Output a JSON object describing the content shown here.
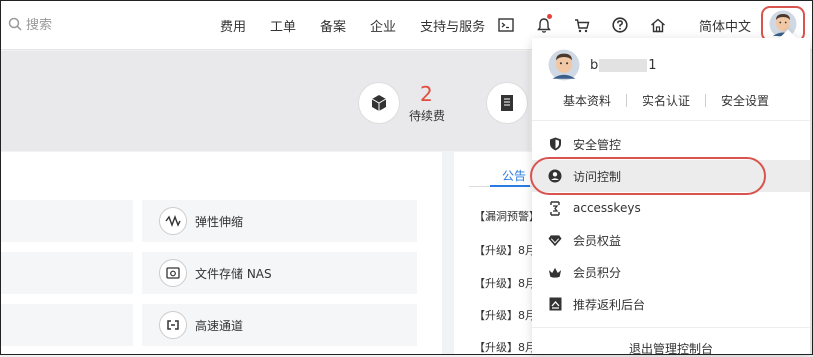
{
  "search": {
    "placeholder": "搜索"
  },
  "nav": [
    {
      "label": "费用"
    },
    {
      "label": "工单"
    },
    {
      "label": "备案"
    },
    {
      "label": "企业"
    },
    {
      "label": "支持与服务"
    }
  ],
  "top_icons": [
    "terminal-icon",
    "bell-icon",
    "cart-icon",
    "help-icon",
    "home-icon"
  ],
  "notification_dot": true,
  "language": "简体中文",
  "stat": {
    "value": "2",
    "label": "待续费"
  },
  "services": [
    {
      "label": "弹性伸缩",
      "icon": "scaling-icon"
    },
    {
      "label": "文件存储 NAS",
      "icon": "nas-icon"
    },
    {
      "label": "高速通道",
      "icon": "express-connect-icon"
    }
  ],
  "notices": {
    "tab": "公告",
    "items": [
      "【漏洞预警】",
      "【升级】8月",
      "【升级】8月",
      "【升级】8月",
      "【升级】8月"
    ]
  },
  "user_menu": {
    "username_start": "b",
    "username_end": "1",
    "links": [
      "基本资料",
      "实名认证",
      "安全设置"
    ],
    "items": [
      {
        "label": "安全管控",
        "icon": "shield-icon"
      },
      {
        "label": "访问控制",
        "icon": "user-circle-icon"
      },
      {
        "label": "accesskeys",
        "icon": "key-icon"
      },
      {
        "label": "会员权益",
        "icon": "diamond-icon"
      },
      {
        "label": "会员积分",
        "icon": "crown-icon"
      },
      {
        "label": "推荐返利后台",
        "icon": "rebate-icon"
      }
    ],
    "highlighted_item": "访问控制",
    "logout": "退出管理控制台"
  },
  "colors": {
    "accent": "#2a7ae2",
    "highlight_ring": "#d9534f",
    "stat_number": "#e14d3a"
  }
}
